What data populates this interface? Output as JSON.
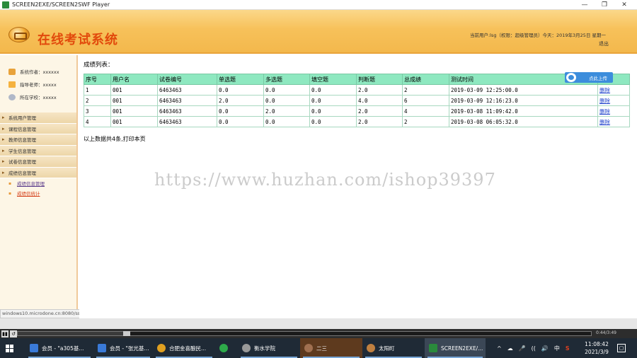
{
  "window": {
    "title": "SCREEN2EXE/SCREEN2SWF Player",
    "min": "—",
    "max": "❐",
    "close": "✕"
  },
  "header": {
    "site_title": "在线考试系统",
    "user_info": "当前用户:lsg（权限：超级管理员）今天：2019年3月25日 星期一",
    "logout": "退出"
  },
  "sidebar": {
    "info": [
      {
        "label": "系统作者：xxxxxx"
      },
      {
        "label": "指导老师：xxxxx"
      },
      {
        "label": "所在学校：xxxxx"
      }
    ],
    "menu": [
      {
        "label": "系统用户管理"
      },
      {
        "label": "课程信息管理"
      },
      {
        "label": "教师信息管理"
      },
      {
        "label": "学生信息管理"
      },
      {
        "label": "试卷信息管理"
      },
      {
        "label": "成绩信息管理"
      }
    ],
    "submenu": [
      {
        "label": "成绩信息管理"
      },
      {
        "label": "成绩信统计"
      }
    ]
  },
  "status_url": "windows10.microdone.cn:8080/ssmzxksxt/cj_list_tj.jsp",
  "content": {
    "section_title": "成绩列表：",
    "upload_label": "点此上传",
    "columns": [
      "序号",
      "用户名",
      "试卷编号",
      "单选题",
      "多选题",
      "填空题",
      "判断题",
      "总成绩",
      "测试时间",
      ""
    ],
    "rows": [
      [
        "1",
        "001",
        "6463463",
        "0.0",
        "0.0",
        "0.0",
        "2.0",
        "2",
        "2019-03-09 12:25:00.0",
        "删除"
      ],
      [
        "2",
        "001",
        "6463463",
        "2.0",
        "0.0",
        "0.0",
        "4.0",
        "6",
        "2019-03-09 12:16:23.0",
        "删除"
      ],
      [
        "3",
        "001",
        "6463463",
        "0.0",
        "2.0",
        "0.0",
        "2.0",
        "4",
        "2019-03-08 11:09:42.0",
        "删除"
      ],
      [
        "4",
        "001",
        "6463463",
        "0.0",
        "0.0",
        "0.0",
        "2.0",
        "2",
        "2019-03-08 06:05:32.0",
        "删除"
      ]
    ],
    "summary": "以上数据共4条,打印本页",
    "watermark": "https://www.huzhan.com/ishop39397"
  },
  "player": {
    "play": "▮▮",
    "rewind": "↺",
    "progress": 0.19,
    "time": "0:44/3:49"
  },
  "taskbar": {
    "items": [
      {
        "label": "会员 - \"a305基...",
        "color": "#3a7ad8"
      },
      {
        "label": "会员 - \"张光基...",
        "color": "#3a7ad8"
      },
      {
        "label": "合肥金喜酿民...",
        "color": "#e0a020"
      },
      {
        "label": "",
        "color": "#2eaa4a"
      },
      {
        "label": "衡水学院",
        "color": "#999999"
      },
      {
        "label": "二三",
        "color": "#a07050"
      },
      {
        "label": "太阳町",
        "color": "#c08040"
      },
      {
        "label": "SCREEN2EXE/...",
        "color": "#2a8a3c"
      }
    ],
    "tray": [
      "^",
      "☁",
      "🎤",
      "((",
      "🔊",
      "中",
      "S"
    ],
    "time": "11:08:42",
    "date": "2021/3/9",
    "notify": "▢"
  }
}
